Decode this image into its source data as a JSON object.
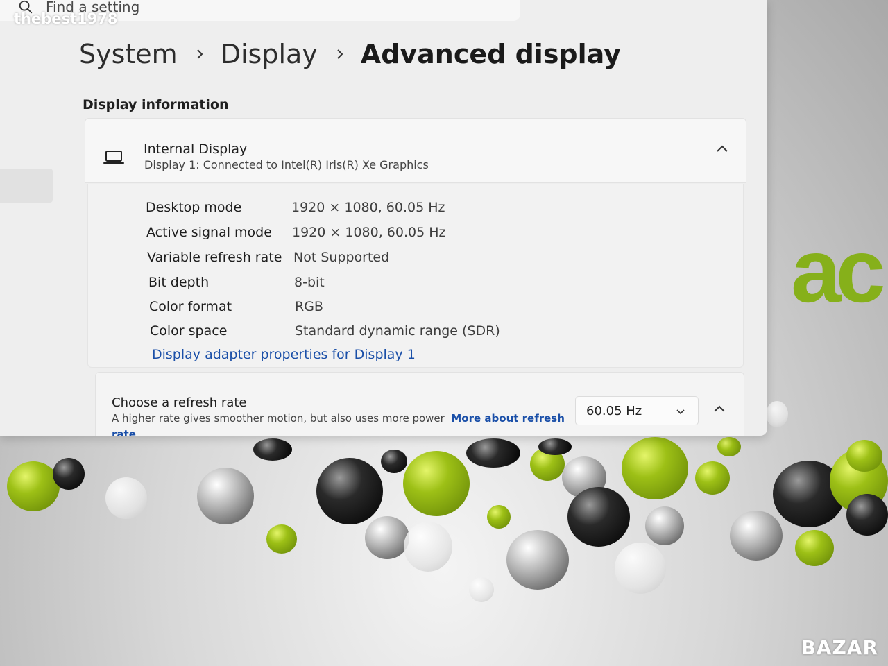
{
  "search": {
    "placeholder": "Find a setting"
  },
  "watermark": {
    "top": "thebest1978",
    "bottom": "BAZAR"
  },
  "wallpaper": {
    "brand_fragment": "ac",
    "accent": "#86b01a"
  },
  "breadcrumb": {
    "items": [
      "System",
      "Display",
      "Advanced display"
    ]
  },
  "section": {
    "title": "Display information"
  },
  "display": {
    "name": "Internal Display",
    "subtitle": "Display 1: Connected to Intel(R) Iris(R) Xe Graphics",
    "icon": "laptop-icon",
    "rows": [
      {
        "label": "Desktop mode",
        "value": "1920 × 1080, 60.05 Hz"
      },
      {
        "label": "Active signal mode",
        "value": "1920 × 1080, 60.05 Hz"
      },
      {
        "label": "Variable refresh rate",
        "value": "Not Supported"
      },
      {
        "label": "Bit depth",
        "value": "8-bit"
      },
      {
        "label": "Color format",
        "value": "RGB"
      },
      {
        "label": "Color space",
        "value": "Standard dynamic range (SDR)"
      }
    ],
    "adapter_link": "Display adapter properties for Display 1"
  },
  "refresh": {
    "title": "Choose a refresh rate",
    "description": "A higher rate gives smoother motion, but also uses more power",
    "link_part1": "More about refresh",
    "link_part2": "rate",
    "selected": "60.05 Hz"
  }
}
